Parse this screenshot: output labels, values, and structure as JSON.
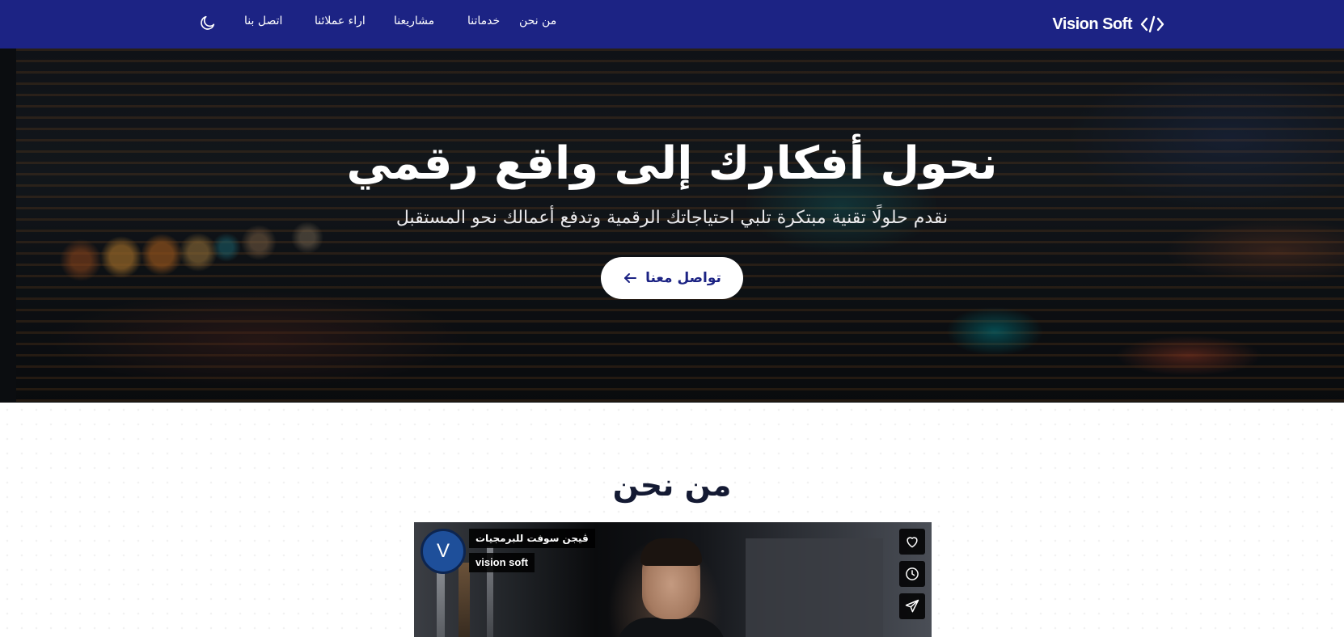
{
  "navbar": {
    "brand": "Vision Soft",
    "brand_icon": "code-icon",
    "links": [
      "من نحن",
      "خدماتنا",
      "مشاريعنا",
      "اراء عملائنا",
      "اتصل بنا"
    ],
    "theme_icon": "moon-icon",
    "background_color": "#1c2384"
  },
  "hero": {
    "title": "نحول أفكارك إلى واقع رقمي",
    "subtitle": "نقدم حلولًا تقنية مبتكرة تلبي احتياجاتك الرقمية وتدفع أعمالك نحو المستقبل",
    "button_label": "تواصل معنا",
    "button_icon": "arrow-left-icon"
  },
  "about": {
    "title": "من نحن",
    "video": {
      "avatar_letter": "V",
      "title": "ڤيجن سوفت للبرمجيات",
      "channel": "vision soft",
      "actions": [
        "heart-icon",
        "clock-icon",
        "send-icon"
      ]
    }
  }
}
